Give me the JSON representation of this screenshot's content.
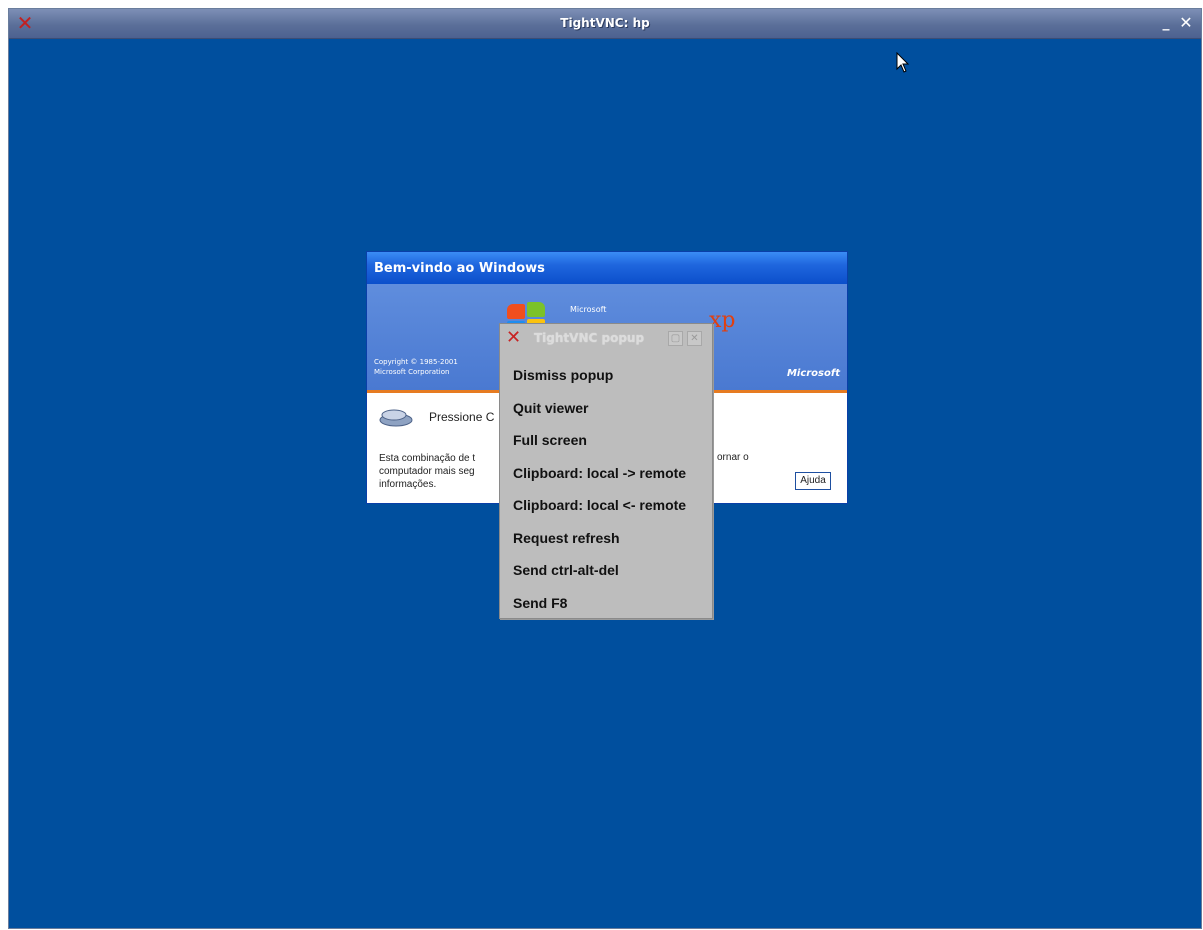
{
  "vnc_window": {
    "title": "TightVNC: hp",
    "app_icon": "tightvnc-x-icon",
    "minimize_label": "_",
    "close_label": "✕"
  },
  "remote_dialog": {
    "title": "Bem-vindo ao Windows",
    "banner": {
      "microsoft_small": "Microsoft",
      "xp_mark": "xp",
      "copyright_line1": "Copyright © 1985-2001",
      "copyright_line2": "Microsoft Corporation",
      "microsoft_logo": "Microsoft"
    },
    "press_text": "Pressione C",
    "body_text": "Esta combinação de t computador mais seg informações.",
    "body_text_right": "ornar o",
    "help_button": "Ajuda"
  },
  "popup": {
    "title": "TightVNC popup",
    "maximize_label": "▢",
    "close_label": "✕",
    "menu": [
      "Dismiss popup",
      "Quit viewer",
      "Full screen",
      "Clipboard: local -> remote",
      "Clipboard: local <- remote",
      "Request refresh",
      "Send ctrl-alt-del",
      "Send F8"
    ]
  },
  "colors": {
    "desktop_background": "#004f9e",
    "popup_background": "#bdbdbd",
    "xp_title_blue": "#1f66de"
  }
}
